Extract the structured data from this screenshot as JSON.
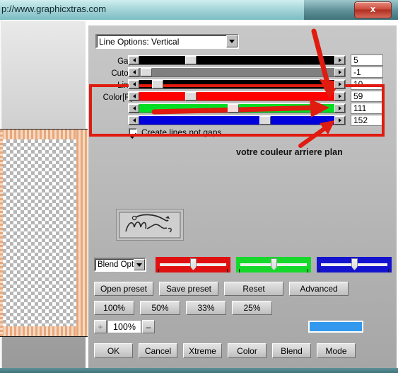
{
  "window": {
    "title": "p://www.graphicxtras.com",
    "close_label": "x"
  },
  "dialog": {
    "mode_combo": {
      "value": "Line Options: Vertical"
    },
    "blend_combo": {
      "value": "Blend Opti"
    },
    "sliders": [
      {
        "label": "Gap:",
        "value": "5",
        "thumb_pct": 23,
        "fill": "#000000"
      },
      {
        "label": "Cutoff:",
        "value": "-1",
        "thumb_pct": 2,
        "fill": "#808080"
      },
      {
        "label": "Line:",
        "value": "10",
        "thumb_pct": 7,
        "fill": "#000000"
      },
      {
        "label": "Color[R]:",
        "value": "59",
        "thumb_pct": 23,
        "fill": "#ff0000"
      },
      {
        "label": "",
        "value": "111",
        "thumb_pct": 44,
        "fill": "#00dd22"
      },
      {
        "label": "",
        "value": "152",
        "thumb_pct": 58,
        "fill": "#0000dd"
      }
    ],
    "checkbox": {
      "label": "Create lines not gaps",
      "checked": true
    },
    "trackbars": [
      {
        "name": "red",
        "color": "#e01010",
        "thumb_pct": 50
      },
      {
        "name": "green",
        "color": "#16d82a",
        "thumb_pct": 50
      },
      {
        "name": "blue",
        "color": "#1313cf",
        "thumb_pct": 50
      }
    ],
    "preset_buttons": [
      "Open preset",
      "Save preset",
      "Reset",
      "Advanced"
    ],
    "zoom_buttons": [
      "100%",
      "50%",
      "33%",
      "25%"
    ],
    "zoom_control": {
      "plus": "+",
      "value": "100%",
      "minus": "–"
    },
    "color_swatch": "#3399ee",
    "action_buttons": [
      "OK",
      "Cancel",
      "Xtreme",
      "Color",
      "Blend",
      "Mode"
    ]
  },
  "annotations": {
    "caption": "votre couleur arriere plan",
    "highlight_color": "#e01b10"
  }
}
